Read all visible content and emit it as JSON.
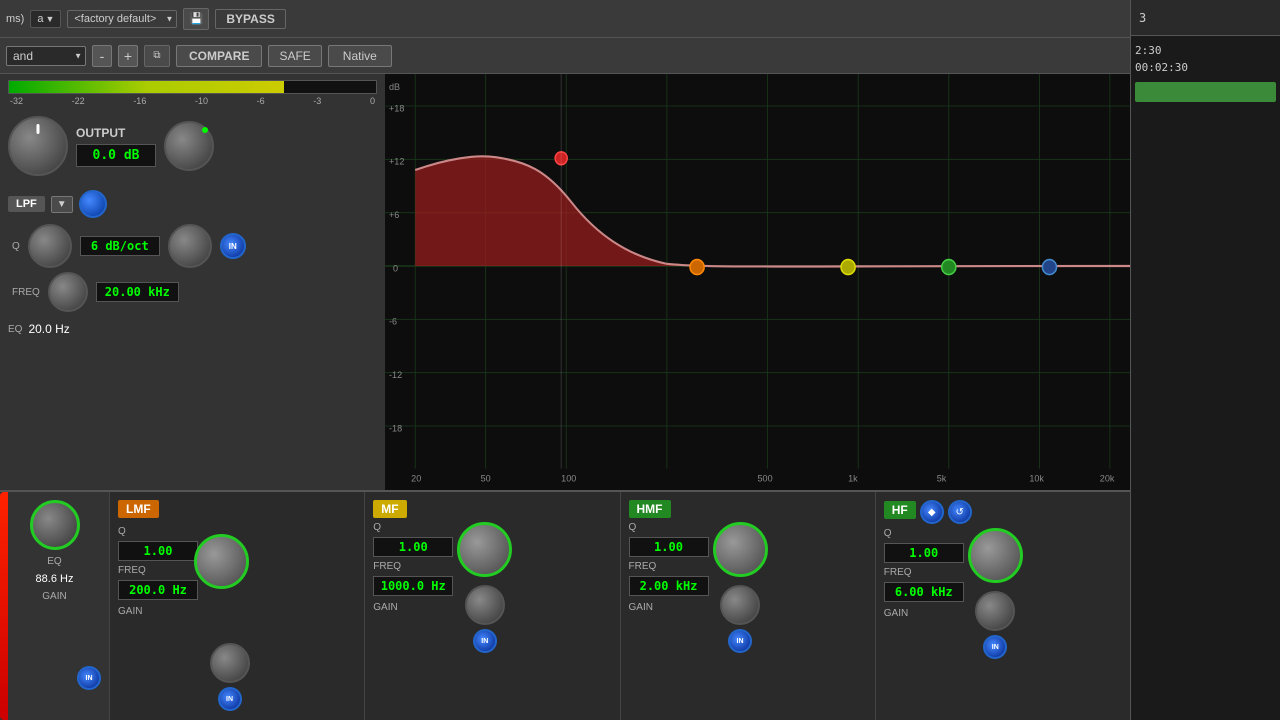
{
  "topbar": {
    "preset_label": "<factory default>",
    "bypass_label": "BYPASS",
    "save_icon": "💾"
  },
  "secondbar": {
    "band_label": "and",
    "minus_label": "-",
    "plus_label": "+",
    "copy_icon": "⧉",
    "compare_label": "COMPARE",
    "safe_label": "SAFE",
    "native_label": "Native"
  },
  "output": {
    "label": "OUTPUT",
    "value": "0.0 dB"
  },
  "lpf": {
    "label": "LPF",
    "rate": "6 dB/oct",
    "q_label": "Q",
    "freq_label": "FREQ",
    "freq_value": "20.00 kHz",
    "in_label": "IN"
  },
  "eq": {
    "freq_label": "EQ",
    "freq_value": "20.0 Hz"
  },
  "meter": {
    "labels": [
      "-32",
      "-22",
      "-16",
      "-10",
      "-6",
      "-3",
      "0"
    ]
  },
  "eq_display": {
    "db_label": "dB",
    "levels": [
      "+18",
      "+12",
      "+6",
      "0",
      "-6",
      "-12",
      "-18"
    ],
    "freqs": [
      "20",
      "50",
      "100",
      "500",
      "1k",
      "5k",
      "10k",
      "20k"
    ]
  },
  "bands": {
    "lmf": {
      "label": "LMF",
      "q_label": "Q",
      "q_value": "1.00",
      "freq_label": "FREQ",
      "freq_value": "200.0 Hz",
      "gain_label": "GAIN",
      "in_label": "IN"
    },
    "mf": {
      "label": "MF",
      "q_label": "Q",
      "q_value": "1.00",
      "freq_label": "FREQ",
      "freq_value": "1000.0 Hz",
      "gain_label": "GAIN",
      "in_label": "IN"
    },
    "hmf": {
      "label": "HMF",
      "q_label": "Q",
      "q_value": "1.00",
      "freq_label": "FREQ",
      "freq_value": "2.00 kHz",
      "gain_label": "GAIN",
      "in_label": "IN"
    },
    "hf": {
      "label": "HF",
      "q_label": "Q",
      "q_value": "1.00",
      "freq_label": "FREQ",
      "freq_value": "6.00 kHz",
      "gain_label": "GAIN",
      "in_label": "IN"
    }
  },
  "timeline": {
    "number": "3",
    "time1": "2:30",
    "time2": "00:02:30"
  },
  "left_band": {
    "freq_value": "88.6 Hz"
  }
}
